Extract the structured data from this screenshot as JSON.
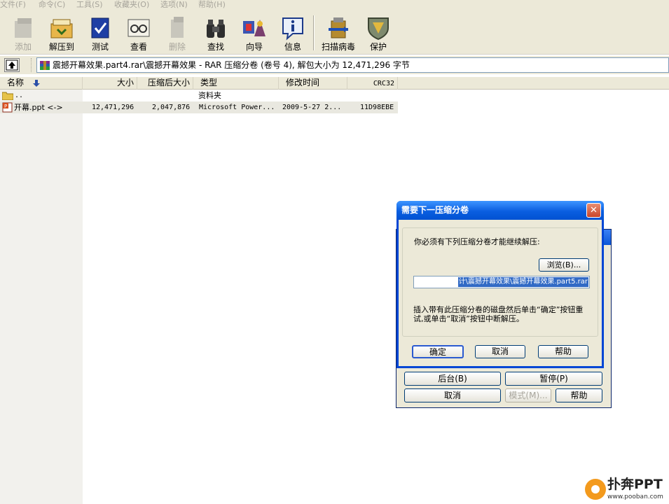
{
  "menu": [
    "文件(F)",
    "命令(C)",
    "工具(S)",
    "收藏夹(O)",
    "选项(N)",
    "帮助(H)"
  ],
  "toolbar": {
    "add": "添加",
    "extract_to": "解压到",
    "test": "测试",
    "view": "查看",
    "delete": "删除",
    "find": "查找",
    "wizard": "向导",
    "info": "信息",
    "virus_scan": "扫描病毒",
    "protect": "保护"
  },
  "address": {
    "path": "震撼开幕效果.part4.rar\\震撼开幕效果 - RAR 压缩分卷 (卷号 4), 解包大小为 12,471,296 字节"
  },
  "columns": {
    "name": "名称",
    "size": "大小",
    "packed": "压缩后大小",
    "type": "类型",
    "modified": "修改时间",
    "crc": "CRC32"
  },
  "files": [
    {
      "name": "..",
      "size": "",
      "packed": "",
      "type": "资料夹",
      "modified": "",
      "crc": ""
    },
    {
      "name": "开幕.ppt <->",
      "size": "12,471,296",
      "packed": "2,047,876",
      "type": "Microsoft Power...",
      "modified": "2009-5-27 2...",
      "crc": "11D98EBE"
    }
  ],
  "progress_dialog": {
    "background_button": "后台(B)",
    "pause_button": "暂停(P)",
    "cancel_button": "取消",
    "mode_button": "模式(M)...",
    "help_button": "帮助"
  },
  "volume_dialog": {
    "title": "需要下一压缩分卷",
    "message": "你必须有下列压缩分卷才能继续解压:",
    "browse_button": "浏览(B)...",
    "path": "计\\震撼开幕效果\\震撼开幕效果.part5.rar",
    "instruction": "插入带有此压缩分卷的磁盘然后单击“确定”按钮重试,或单击“取消”按钮中断解压。",
    "ok_button": "确定",
    "cancel_button": "取消",
    "help_button": "帮助"
  },
  "watermark": {
    "brand": "扑奔PPT",
    "url": "www.pooban.com"
  }
}
